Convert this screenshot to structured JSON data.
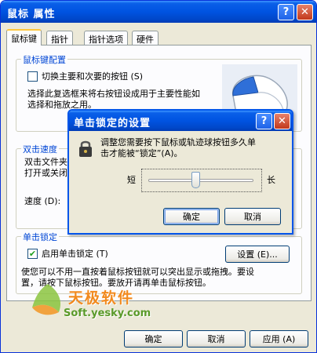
{
  "window": {
    "title": "鼠标 属性",
    "help": "?",
    "close": "✕"
  },
  "tabs": [
    "鼠标键",
    "指针",
    "指针选项",
    "硬件"
  ],
  "button_config": {
    "title": "鼠标键配置",
    "switch_label": "切换主要和次要的按钮 (S)",
    "description": "选择此复选框来将右按钮设成用于主要性能如选择和拖放之用。"
  },
  "double_click": {
    "title": "双击速度",
    "line1": "双击文件夹",
    "line2": "打开或关闭",
    "speed_label": "速度 (D):"
  },
  "click_lock": {
    "title": "单击锁定",
    "enable_label": "启用单击锁定 (T)",
    "settings_button": "设置 (E)...",
    "description_line1": "使您可以不用一直按着鼠标按钮就可以突出显示或拖拽。要设",
    "description_line2": "置，请按下鼠标按钮。要放开请再单击鼠标按钮。"
  },
  "footer": {
    "ok": "确定",
    "cancel": "取消",
    "apply": "应用 (A)"
  },
  "dialog": {
    "title": "单击锁定的设置",
    "help": "?",
    "close": "✕",
    "text_line1": "调整您需要按下鼠标或轨迹球按钮多久单",
    "text_line2": "击才能被“锁定”(A)。",
    "short_label": "短",
    "long_label": "长",
    "slider_level": 0.45,
    "ok": "确定",
    "cancel": "取消"
  },
  "watermark": {
    "brand": "天极软件",
    "url": "Soft.yesky.com"
  },
  "colors": {
    "title_blue": "#0053e1",
    "group_title": "#0046d5",
    "face": "#ece9d8"
  }
}
